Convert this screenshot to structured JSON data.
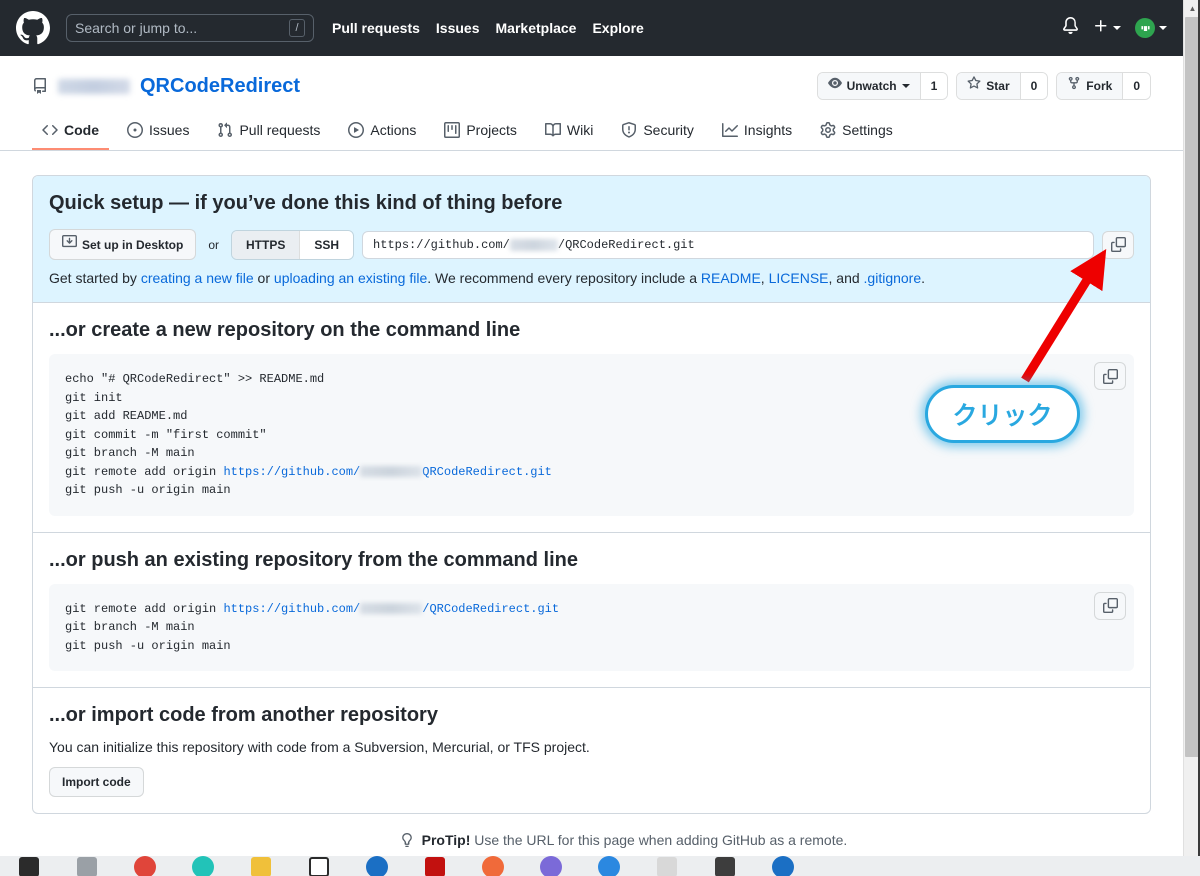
{
  "header": {
    "logo_icon": "github-mark-icon",
    "search_placeholder": "Search or jump to...",
    "search_value": "",
    "slash_hint": "/",
    "nav": [
      {
        "label": "Pull requests"
      },
      {
        "label": "Issues"
      },
      {
        "label": "Marketplace"
      },
      {
        "label": "Explore"
      }
    ],
    "notifications_icon": "bell-icon",
    "create_new_icon": "plus-icon",
    "account_icon": "avatar-icon"
  },
  "repo": {
    "repo_icon": "repository-icon",
    "owner": "",
    "name": "QRCodeRedirect",
    "actions": [
      {
        "icon": "eye-icon",
        "label": "Unwatch",
        "count": "1",
        "has_caret": true
      },
      {
        "icon": "star-icon",
        "label": "Star",
        "count": "0",
        "has_caret": false
      },
      {
        "icon": "fork-icon",
        "label": "Fork",
        "count": "0",
        "has_caret": false
      }
    ],
    "tabs": [
      {
        "icon": "code-icon",
        "label": "Code",
        "active": true
      },
      {
        "icon": "issue-opened-icon",
        "label": "Issues",
        "active": false
      },
      {
        "icon": "git-pull-request-icon",
        "label": "Pull requests",
        "active": false
      },
      {
        "icon": "play-icon",
        "label": "Actions",
        "active": false
      },
      {
        "icon": "project-icon",
        "label": "Projects",
        "active": false
      },
      {
        "icon": "book-icon",
        "label": "Wiki",
        "active": false
      },
      {
        "icon": "shield-icon",
        "label": "Security",
        "active": false
      },
      {
        "icon": "graph-icon",
        "label": "Insights",
        "active": false
      },
      {
        "icon": "gear-icon",
        "label": "Settings",
        "active": false
      }
    ]
  },
  "quick_setup": {
    "title": "Quick setup — if you’ve done this kind of thing before",
    "desktop_button": "Set up in Desktop",
    "desktop_icon": "desktop-download-icon",
    "or_label": "or",
    "protocol_https": "HTTPS",
    "protocol_ssh": "SSH",
    "protocol_selected": "HTTPS",
    "clone_url_prefix": "https://github.com/",
    "clone_url_suffix": "/QRCodeRedirect.git",
    "copy_icon": "clipboard-icon",
    "help_prefix": "Get started by ",
    "help_link_create": "creating a new file",
    "help_mid1": " or ",
    "help_link_upload": "uploading an existing file",
    "help_mid2": ". We recommend every repository include a ",
    "help_link_readme": "README",
    "help_comma1": ", ",
    "help_link_license": "LICENSE",
    "help_mid3": ", and ",
    "help_link_gitignore": ".gitignore",
    "help_end": "."
  },
  "create_repo_section": {
    "title": "...or create a new repository on the command line",
    "copy_icon": "clipboard-icon",
    "lines_before": "echo \"# QRCodeRedirect\" >> README.md\ngit init\ngit add README.md\ngit commit -m \"first commit\"\ngit branch -M main\ngit remote add origin ",
    "url_prefix": "https://github.com/",
    "url_suffix": "QRCodeRedirect.git",
    "lines_after": "\ngit push -u origin main"
  },
  "push_repo_section": {
    "title": "...or push an existing repository from the command line",
    "copy_icon": "clipboard-icon",
    "line_prefix": "git remote add origin ",
    "url_prefix": "https://github.com/",
    "url_suffix": "/QRCodeRedirect.git",
    "lines_after": "\ngit branch -M main\ngit push -u origin main"
  },
  "import_section": {
    "title": "...or import code from another repository",
    "description": "You can initialize this repository with code from a Subversion, Mercurial, or TFS project.",
    "button": "Import code"
  },
  "protip": {
    "icon": "light-bulb-icon",
    "label": "ProTip!",
    "text": " Use the URL for this page when adding GitHub as a remote."
  },
  "annotation": {
    "callout_text": "クリック",
    "callout_color": "#29a8e0",
    "arrow_color": "#ee0000",
    "arrow_target": "clone-url-copy-button"
  },
  "colors": {
    "header_bg": "#24292f",
    "link": "#0969da",
    "quick_setup_bg": "#ddf4ff",
    "active_tab_underline": "#fd8c73",
    "code_bg": "#f6f8fa"
  }
}
